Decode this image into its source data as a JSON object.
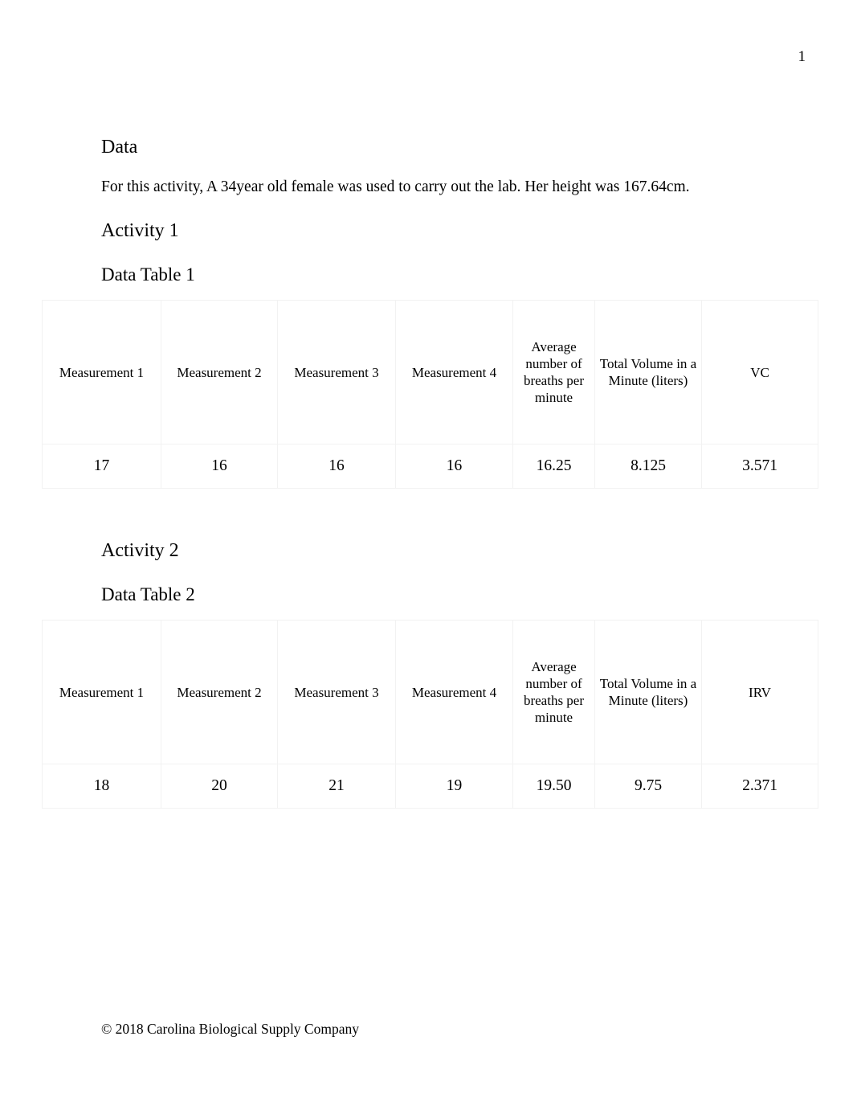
{
  "document": {
    "page_number": "1",
    "footer": "© 2018 Carolina Biological Supply Company"
  },
  "sections": {
    "data_heading": "Data",
    "intro_paragraph": "For this activity, A 34year old female was used to carry out the lab. Her height was 167.64cm.",
    "activity_1_heading": "Activity 1",
    "data_table_1_heading": "Data Table 1",
    "activity_2_heading": "Activity 2",
    "data_table_2_heading": "Data Table 2"
  },
  "table1": {
    "headers": [
      "Measurement 1",
      "Measurement 2",
      "Measurement 3",
      "Measurement 4",
      "Average number of breaths per minute",
      "Total Volume in a Minute (liters)",
      "VC"
    ],
    "rows": [
      [
        "17",
        "16",
        "16",
        "16",
        "16.25",
        "8.125",
        "3.571"
      ]
    ]
  },
  "table2": {
    "headers": [
      "Measurement 1",
      "Measurement 2",
      "Measurement 3",
      "Measurement 4",
      "Average number of breaths per minute",
      "Total Volume in a Minute (liters)",
      "IRV"
    ],
    "rows": [
      [
        "18",
        "20",
        "21",
        "19",
        "19.50",
        "9.75",
        "2.371"
      ]
    ]
  }
}
